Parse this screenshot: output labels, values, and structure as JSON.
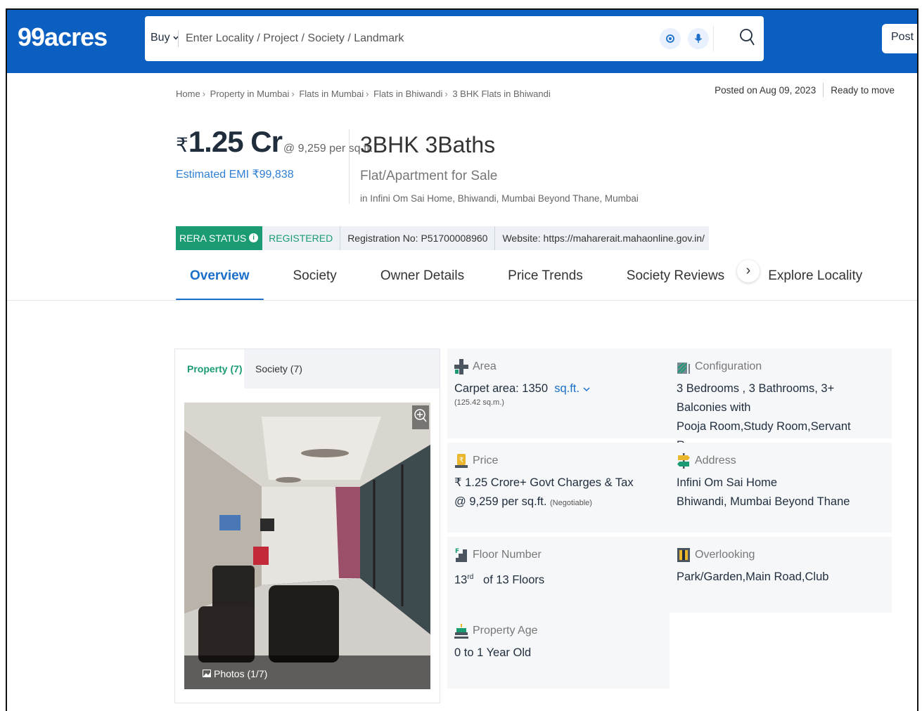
{
  "brand": {
    "logo_text": "99acres",
    "header_color": "#0b5fc1",
    "accent": "#1b9b74"
  },
  "search": {
    "mode": "Buy",
    "placeholder": "Enter Locality / Project / Society / Landmark",
    "icons": [
      "location-icon",
      "mic-icon",
      "search-icon"
    ]
  },
  "post_button": "Post p",
  "breadcrumb": [
    "Home",
    "Property in Mumbai",
    "Flats in Mumbai",
    "Flats in Bhiwandi",
    "3 BHK Flats in Bhiwandi"
  ],
  "posted": {
    "date": "Posted on Aug 09, 2023",
    "status": "Ready to move"
  },
  "listing": {
    "rupee": "₹",
    "price": "1.25 Cr",
    "per_sqft": "@ 9,259 per sq.ft.",
    "emi": "Estimated EMI ₹99,838",
    "title": "3BHK 3Baths",
    "type": "Flat/Apartment for Sale",
    "location": "in Infini Om Sai Home, Bhiwandi, Mumbai Beyond Thane, Mumbai"
  },
  "rera": {
    "status_label": "RERA STATUS",
    "status": "REGISTERED",
    "registration": "Registration No: P51700008960",
    "website": "Website: https://maharerait.mahaonline.gov.in/"
  },
  "tabs": [
    "Overview",
    "Society",
    "Owner Details",
    "Price Trends",
    "Society Reviews",
    "Explore Locality"
  ],
  "gallery": {
    "tabs": [
      "Property (7)",
      "Society (7)"
    ],
    "photos_label": "Photos (1/7)"
  },
  "details": {
    "area": {
      "label": "Area",
      "value": "Carpet area: 1350",
      "unit": "sq.ft.",
      "sub": "(125.42 sq.m.)"
    },
    "configuration": {
      "label": "Configuration",
      "line1": "3 Bedrooms , 3 Bathrooms, 3+ Balconies with",
      "line2": "Pooja Room,Study Room,Servant Room"
    },
    "price": {
      "label": "Price",
      "line1": "₹ 1.25 Crore+ Govt Charges & Tax",
      "line2": "@ 9,259 per sq.ft.",
      "note": "(Negotiable)"
    },
    "address": {
      "label": "Address",
      "line1": "Infini Om Sai Home",
      "line2": "Bhiwandi, Mumbai Beyond Thane"
    },
    "floor": {
      "label": "Floor Number",
      "num": "13",
      "sup": "rd",
      "rest": "of 13 Floors"
    },
    "overlooking": {
      "label": "Overlooking",
      "value": "Park/Garden,Main Road,Club"
    },
    "age": {
      "label": "Property Age",
      "value": "0 to 1 Year Old"
    }
  }
}
